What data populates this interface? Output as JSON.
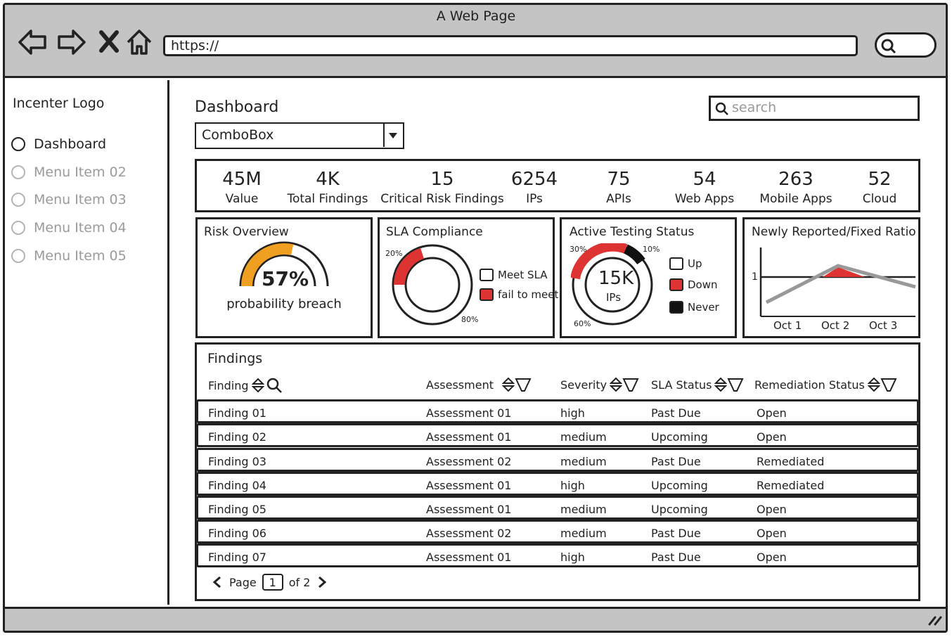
{
  "window": {
    "title": "A Web Page",
    "url": "https://"
  },
  "sidebar": {
    "logo": "Incenter Logo",
    "items": [
      {
        "label": "Dashboard"
      },
      {
        "label": "Menu Item 02"
      },
      {
        "label": "Menu Item 03"
      },
      {
        "label": "Menu Item 04"
      },
      {
        "label": "Menu Item 05"
      }
    ]
  },
  "main": {
    "title": "Dashboard",
    "combobox": "ComboBox",
    "search_placeholder": "search"
  },
  "stats": [
    {
      "value": "45M",
      "label": "Value"
    },
    {
      "value": "4K",
      "label": "Total Findings"
    },
    {
      "value": "15",
      "label": "Critical Risk Findings"
    },
    {
      "value": "6254",
      "label": "IPs"
    },
    {
      "value": "75",
      "label": "APIs"
    },
    {
      "value": "54",
      "label": "Web Apps"
    },
    {
      "value": "263",
      "label": "Mobile Apps"
    },
    {
      "value": "52",
      "label": "Cloud"
    }
  ],
  "cards": {
    "risk": {
      "title": "Risk Overview",
      "value": "57%",
      "caption": "probability breach",
      "fraction": 0.57,
      "color": "#f0a020"
    },
    "sla": {
      "title": "SLA Compliance",
      "pct_low": "20%",
      "pct_high": "80%",
      "legend_meet": "Meet SLA",
      "legend_fail": "fail to meet",
      "fail_fraction": 0.2,
      "fail_color": "#d33"
    },
    "testing": {
      "title": "Active Testing Status",
      "value": "15K",
      "unit": "IPs",
      "pct_up": "30%",
      "pct_never": "10%",
      "pct_down": "60%",
      "legend_up": "Up",
      "legend_down": "Down",
      "legend_never": "Never"
    },
    "ratio": {
      "title": "Newly Reported/Fixed Ratio",
      "y_tick": "1",
      "x_ticks": [
        "Oct 1",
        "Oct 2",
        "Oct 3"
      ]
    }
  },
  "findings": {
    "title": "Findings",
    "columns": [
      "Finding",
      "Assessment",
      "Severity",
      "SLA Status",
      "Remediation Status"
    ],
    "rows": [
      [
        "Finding 01",
        "Assessment 01",
        "high",
        "Past Due",
        "Open"
      ],
      [
        "Finding 02",
        "Assessment 01",
        "medium",
        "Upcoming",
        "Open"
      ],
      [
        "Finding 03",
        "Assessment 02",
        "medium",
        "Past Due",
        "Remediated"
      ],
      [
        "Finding 04",
        "Assessment 01",
        "high",
        "Upcoming",
        "Remediated"
      ],
      [
        "Finding 05",
        "Assessment 01",
        "medium",
        "Upcoming",
        "Open"
      ],
      [
        "Finding 06",
        "Assessment 02",
        "medium",
        "Past Due",
        "Open"
      ],
      [
        "Finding 07",
        "Assessment 01",
        "high",
        "Past Due",
        "Open"
      ]
    ],
    "pager": {
      "label": "Page",
      "current": "1",
      "of": "of 2"
    }
  }
}
